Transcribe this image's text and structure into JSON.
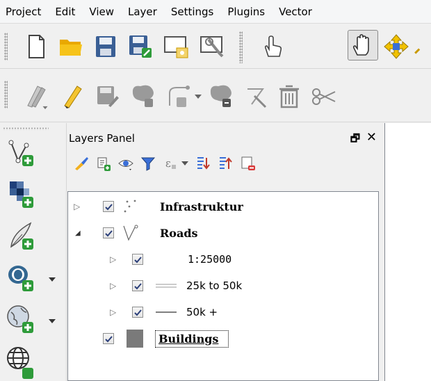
{
  "menubar": {
    "items": [
      "Project",
      "Edit",
      "View",
      "Layer",
      "Settings",
      "Plugins",
      "Vector"
    ]
  },
  "toolbar1": {
    "icons": [
      "new-project-icon",
      "open-project-icon",
      "save-project-icon",
      "save-as-icon",
      "new-print-composer-icon",
      "composer-manager-icon",
      "touch-zoom-pan-icon",
      "pan-map-icon",
      "pan-to-selection-icon"
    ],
    "active": "pan-map-icon"
  },
  "toolbar2": {
    "icons": [
      "current-edits-icon",
      "toggle-editing-icon",
      "save-layer-edits-icon",
      "add-feature-icon",
      "add-circular-string-icon",
      "move-feature-icon",
      "node-tool-icon",
      "delete-selected-icon",
      "cut-features-icon"
    ]
  },
  "left_toolbar": {
    "icons": [
      "add-vector-layer-icon",
      "add-raster-layer-icon",
      "add-delimited-text-icon",
      "add-postgis-layer-icon",
      "add-wms-layer-icon",
      "add-wcs-layer-icon"
    ]
  },
  "layers_panel": {
    "title": "Layers Panel",
    "float_glyph": "🗗",
    "close_glyph": "✕",
    "tool_icons": [
      "add-group-icon",
      "manage-visibility-icon",
      "filter-legend-icon",
      "filter-expression-icon",
      "expand-all-icon",
      "collapse-all-icon",
      "remove-layer-icon"
    ],
    "layers": [
      {
        "label": "Infrastruktur",
        "checked": true,
        "bold": true,
        "expander": "▷"
      },
      {
        "label": "Roads",
        "checked": true,
        "bold": true,
        "expander": "◢"
      },
      {
        "label": "1:25000",
        "checked": true,
        "bold": false,
        "expander": "▷"
      },
      {
        "label": "25k to 50k",
        "checked": true,
        "bold": false,
        "expander": "▷"
      },
      {
        "label": "50k +",
        "checked": true,
        "bold": false,
        "expander": "▷"
      },
      {
        "label": "Buildings",
        "checked": true,
        "bold": true,
        "expander": ""
      }
    ]
  },
  "colors": {
    "accent_green": "#2e9b3a",
    "folder_yellow": "#f0b000",
    "save_blue": "#3a5f95"
  }
}
